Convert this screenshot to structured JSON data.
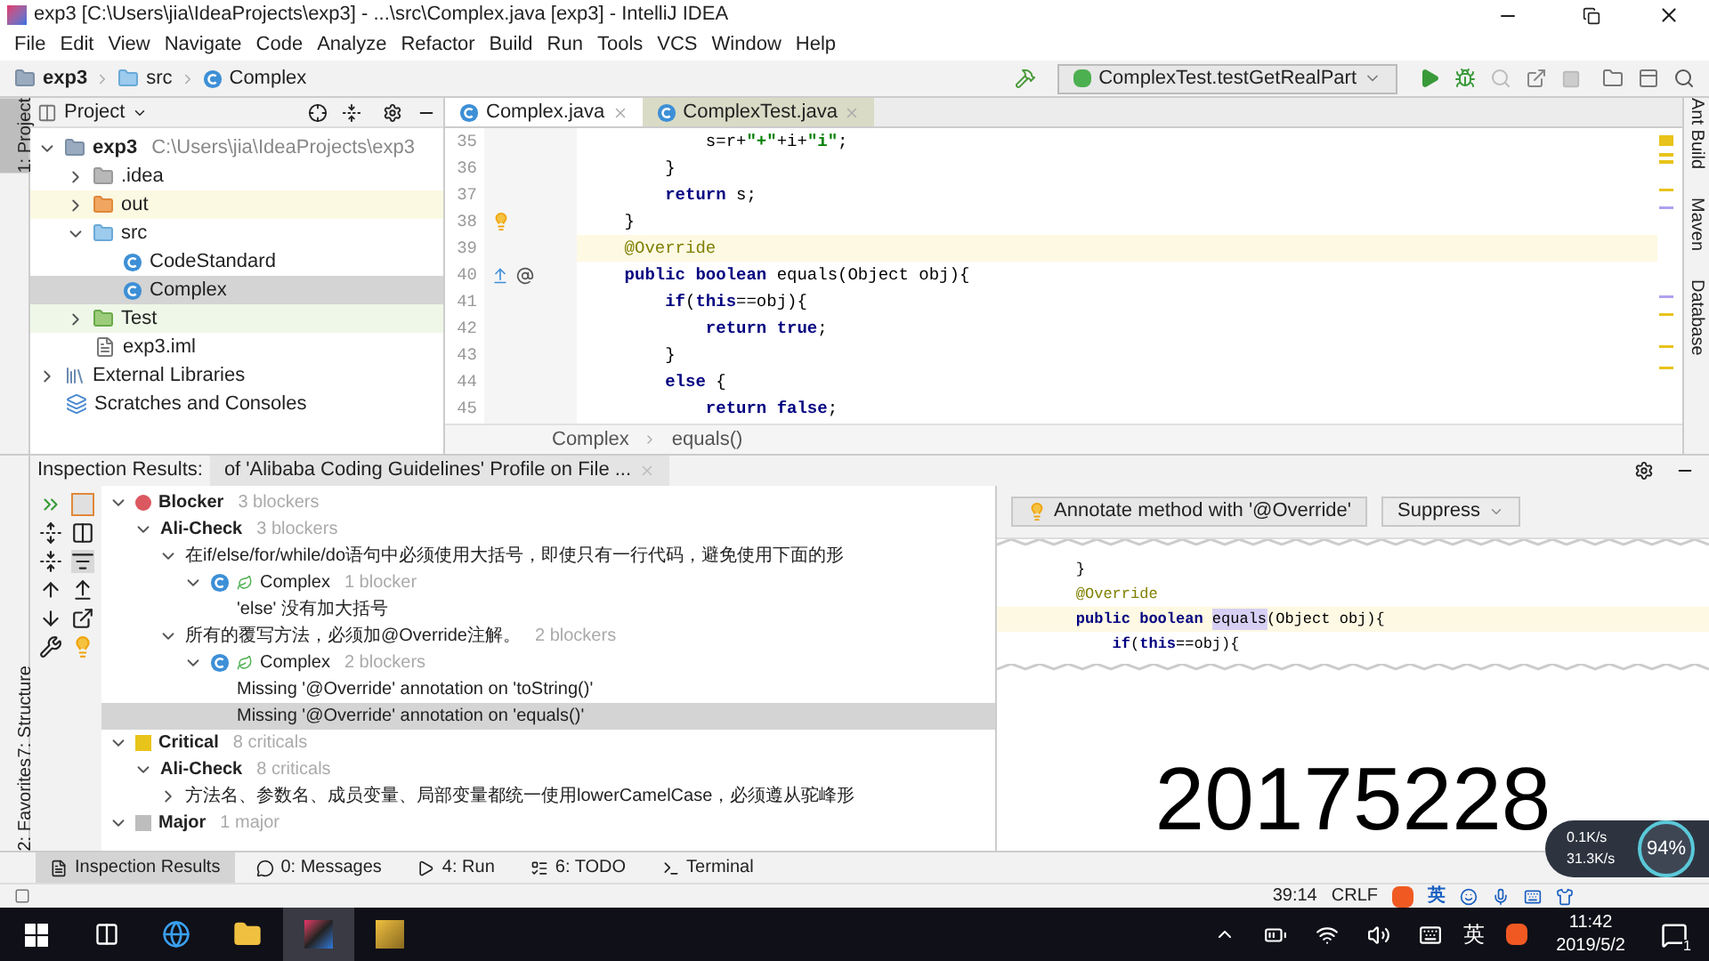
{
  "window": {
    "title": "exp3 [C:\\Users\\jia\\IdeaProjects\\exp3] - ...\\src\\Complex.java [exp3] - IntelliJ IDEA"
  },
  "menu": [
    "File",
    "Edit",
    "View",
    "Navigate",
    "Code",
    "Analyze",
    "Refactor",
    "Build",
    "Run",
    "Tools",
    "VCS",
    "Window",
    "Help"
  ],
  "navbar": {
    "crumbs": [
      {
        "label": "exp3",
        "kind": "module"
      },
      {
        "label": "src",
        "kind": "folder"
      },
      {
        "label": "Complex",
        "kind": "class"
      }
    ],
    "run_config": "ComplexTest.testGetRealPart"
  },
  "left_stripe": {
    "top": [
      {
        "label": "1: Project",
        "selected": true
      }
    ],
    "bottom": [
      {
        "label": "7: Structure",
        "selected": false
      },
      {
        "label": "2: Favorites",
        "selected": false
      }
    ]
  },
  "project": {
    "title": "Project",
    "tree": [
      {
        "label": "exp3",
        "path": "C:\\Users\\jia\\IdeaProjects\\exp3",
        "kind": "module",
        "expanded": true,
        "selected": false,
        "children": [
          {
            "label": ".idea",
            "kind": "folder",
            "expanded": false,
            "selected": false
          },
          {
            "label": "out",
            "kind": "excluded",
            "expanded": false,
            "selected": false
          },
          {
            "label": "src",
            "kind": "source",
            "expanded": true,
            "selected": false,
            "children": [
              {
                "label": "CodeStandard",
                "kind": "class",
                "selected": false
              },
              {
                "label": "Complex",
                "kind": "class",
                "selected": true
              }
            ]
          },
          {
            "label": "Test",
            "kind": "test",
            "expanded": false,
            "selected": false
          },
          {
            "label": "exp3.iml",
            "kind": "file",
            "selected": false
          }
        ]
      },
      {
        "label": "External Libraries",
        "kind": "library",
        "expanded": false,
        "selected": false
      },
      {
        "label": "Scratches and Consoles",
        "kind": "scratches",
        "selected": false
      }
    ]
  },
  "editor": {
    "tabs": [
      {
        "label": "Complex.java",
        "selected": true
      },
      {
        "label": "ComplexTest.java",
        "selected": false
      }
    ],
    "lines": [
      {
        "number": "35",
        "current": false,
        "bulb": false,
        "overridden": false,
        "tokens": [
          {
            "text": "            s=r+",
            "kind": "plain"
          },
          {
            "text": "\"+\"",
            "kind": "string"
          },
          {
            "text": "+i+",
            "kind": "plain"
          },
          {
            "text": "\"i\"",
            "kind": "string"
          },
          {
            "text": ";",
            "kind": "plain"
          }
        ]
      },
      {
        "number": "36",
        "current": false,
        "bulb": false,
        "overridden": false,
        "tokens": [
          {
            "text": "        }",
            "kind": "plain"
          }
        ]
      },
      {
        "number": "37",
        "current": false,
        "bulb": false,
        "overridden": false,
        "tokens": [
          {
            "text": "        return",
            "kind": "keyword"
          },
          {
            "text": " s;",
            "kind": "plain"
          }
        ]
      },
      {
        "number": "38",
        "current": false,
        "bulb": true,
        "overridden": false,
        "tokens": [
          {
            "text": "    }",
            "kind": "plain"
          }
        ]
      },
      {
        "number": "39",
        "current": true,
        "bulb": false,
        "overridden": false,
        "tokens": [
          {
            "text": "    @Override",
            "kind": "annotation"
          }
        ]
      },
      {
        "number": "40",
        "current": false,
        "bulb": false,
        "overridden": true,
        "tokens": [
          {
            "text": "    public boolean",
            "kind": "keyword"
          },
          {
            "text": " equals(Object obj){",
            "kind": "plain"
          }
        ]
      },
      {
        "number": "41",
        "current": false,
        "bulb": false,
        "overridden": false,
        "tokens": [
          {
            "text": "        if",
            "kind": "keyword"
          },
          {
            "text": "(",
            "kind": "plain"
          },
          {
            "text": "this",
            "kind": "keyword"
          },
          {
            "text": "==obj){",
            "kind": "plain"
          }
        ]
      },
      {
        "number": "42",
        "current": false,
        "bulb": false,
        "overridden": false,
        "tokens": [
          {
            "text": "            return true",
            "kind": "keyword"
          },
          {
            "text": ";",
            "kind": "plain"
          }
        ]
      },
      {
        "number": "43",
        "current": false,
        "bulb": false,
        "overridden": false,
        "tokens": [
          {
            "text": "        }",
            "kind": "plain"
          }
        ]
      },
      {
        "number": "44",
        "current": false,
        "bulb": false,
        "overridden": false,
        "tokens": [
          {
            "text": "        else",
            "kind": "keyword"
          },
          {
            "text": " {",
            "kind": "plain"
          }
        ]
      },
      {
        "number": "45",
        "current": false,
        "bulb": false,
        "overridden": false,
        "tokens": [
          {
            "text": "            return false",
            "kind": "keyword"
          },
          {
            "text": ";",
            "kind": "plain"
          }
        ]
      }
    ],
    "breadcrumbs": [
      "Complex",
      "equals()"
    ]
  },
  "right_stripe": [
    "Ant Build",
    "Maven",
    "Database"
  ],
  "inspection": {
    "label": "Inspection Results:",
    "tab": "of 'Alibaba Coding Guidelines' Profile on File ...",
    "tree": [
      {
        "kind": "blocker",
        "color": "#db5860",
        "label": "Blocker",
        "count": "3 blockers",
        "expanded": true,
        "selected": false,
        "children": [
          {
            "kind": "group",
            "label": "Ali-Check",
            "count": "3 blockers",
            "expanded": true,
            "selected": false,
            "children": [
              {
                "kind": "rule",
                "label": "在if/else/for/while/do语句中必须使用大括号，即使只有一行代码，避免使用下面的形",
                "expanded": true,
                "selected": false,
                "children": [
                  {
                    "kind": "file",
                    "label": "Complex",
                    "count": "1 blocker",
                    "expanded": true,
                    "selected": false,
                    "children": [
                      {
                        "kind": "problem",
                        "label": "'else' 没有加大括号",
                        "selected": false
                      }
                    ]
                  }
                ]
              },
              {
                "kind": "rule",
                "label": "所有的覆写方法，必须加@Override注解。",
                "count": "2 blockers",
                "expanded": true,
                "selected": false,
                "children": [
                  {
                    "kind": "file",
                    "label": "Complex",
                    "count": "2 blockers",
                    "expanded": true,
                    "selected": false,
                    "children": [
                      {
                        "kind": "problem",
                        "label": "Missing '@Override' annotation on 'toString()'",
                        "selected": false
                      },
                      {
                        "kind": "problem",
                        "label": "Missing '@Override' annotation on 'equals()'",
                        "selected": true
                      }
                    ]
                  }
                ]
              }
            ]
          }
        ]
      },
      {
        "kind": "critical",
        "color": "#e8c31a",
        "label": "Critical",
        "count": "8 criticals",
        "expanded": true,
        "selected": false,
        "children": [
          {
            "kind": "group",
            "label": "Ali-Check",
            "count": "8 criticals",
            "expanded": true,
            "selected": false,
            "children": [
              {
                "kind": "rule",
                "label": "方法名、参数名、成员变量、局部变量都统一使用lowerCamelCase，必须遵从驼峰形",
                "expanded": false,
                "selected": false
              }
            ]
          }
        ]
      },
      {
        "kind": "major",
        "color": "#bdbdbd",
        "label": "Major",
        "count": "1 major",
        "expanded": true,
        "selected": false
      }
    ],
    "fix_button": "Annotate method with '@Override'",
    "suppress": "Suppress",
    "preview": [
      {
        "current": false,
        "tokens": [
          {
            "text": "    }",
            "kind": "plain"
          }
        ]
      },
      {
        "current": false,
        "tokens": [
          {
            "text": "    @Override",
            "kind": "annotation"
          }
        ]
      },
      {
        "current": true,
        "tokens": [
          {
            "text": "    public boolean ",
            "kind": "keyword"
          },
          {
            "text": "equals",
            "kind": "match"
          },
          {
            "text": "(Object obj){",
            "kind": "plain"
          }
        ]
      },
      {
        "current": false,
        "tokens": [
          {
            "text": "        if",
            "kind": "keyword"
          },
          {
            "text": "(",
            "kind": "plain"
          },
          {
            "text": "this",
            "kind": "keyword"
          },
          {
            "text": "==obj){",
            "kind": "plain"
          }
        ]
      }
    ],
    "caption": "20175228"
  },
  "tool_tabs": [
    {
      "label": "Inspection Results",
      "selected": true
    },
    {
      "label": "0: Messages",
      "selected": false
    },
    {
      "label": "4: Run",
      "selected": false
    },
    {
      "label": "6: TODO",
      "selected": false
    },
    {
      "label": "Terminal",
      "selected": false
    }
  ],
  "status": {
    "position": "39:14",
    "line_sep": "CRLF",
    "ime": "英"
  },
  "net_widget": {
    "up": "0.1K/s",
    "down": "31.3K/s",
    "percent": "94%"
  },
  "taskbar": {
    "ime": "英",
    "time": "11:42",
    "date": "2019/5/2",
    "notifications": "1"
  }
}
